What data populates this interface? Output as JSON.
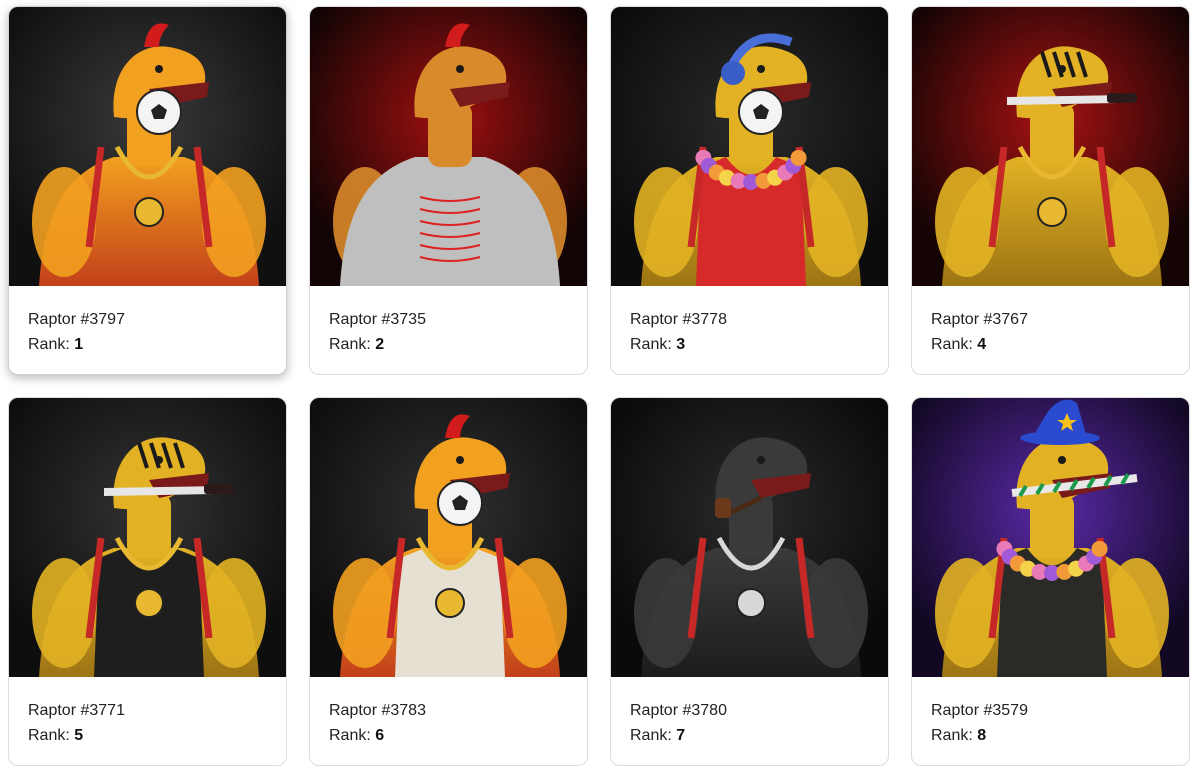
{
  "cards": [
    {
      "name": "Raptor #3797",
      "rank_label": "Rank:",
      "rank": "1",
      "bg": "#101010",
      "glow": "#3a3a3a",
      "skin": "#f2a020",
      "skin_dark": "#c2401a",
      "outfit": "none",
      "outfit_color": "#e63a1a",
      "accessory": "soccer-ball",
      "hat": "mohawk",
      "chain": "gold-watch",
      "hovered": true
    },
    {
      "name": "Raptor #3735",
      "rank_label": "Rank:",
      "rank": "2",
      "bg": "#120404",
      "glow": "#a01010",
      "skin": "#d98a2a",
      "skin_dark": "#7a7a7a",
      "outfit": "armor",
      "outfit_color": "#bfbfbf",
      "accessory": "none",
      "hat": "mohawk",
      "chain": "none",
      "hovered": false
    },
    {
      "name": "Raptor #3778",
      "rank_label": "Rank:",
      "rank": "3",
      "bg": "#0c0c0c",
      "glow": "#2a2a2a",
      "skin": "#e2b224",
      "skin_dark": "#9c7414",
      "outfit": "tank",
      "outfit_color": "#d62a2a",
      "accessory": "soccer-ball",
      "hat": "headphones",
      "chain": "lei",
      "hovered": false
    },
    {
      "name": "Raptor #3767",
      "rank_label": "Rank:",
      "rank": "4",
      "bg": "#150404",
      "glow": "#a81212",
      "skin": "#e2b224",
      "skin_dark": "#9c7414",
      "outfit": "none",
      "outfit_color": "#e2b224",
      "accessory": "knife",
      "hat": "tiger-stripes",
      "chain": "gold-x",
      "hovered": false
    },
    {
      "name": "Raptor #3771",
      "rank_label": "Rank:",
      "rank": "5",
      "bg": "#0e0e0e",
      "glow": "#333333",
      "skin": "#e2b224",
      "skin_dark": "#9c7414",
      "outfit": "tank",
      "outfit_color": "#1e1e1e",
      "accessory": "knife",
      "hat": "tiger-stripes",
      "chain": "gold-x",
      "hovered": false
    },
    {
      "name": "Raptor #3783",
      "rank_label": "Rank:",
      "rank": "6",
      "bg": "#0e0e0e",
      "glow": "#303030",
      "skin": "#f2a020",
      "skin_dark": "#c2401a",
      "outfit": "tank",
      "outfit_color": "#e6e0d2",
      "accessory": "soccer-ball",
      "hat": "mohawk",
      "chain": "gold-gem",
      "hovered": false
    },
    {
      "name": "Raptor #3780",
      "rank_label": "Rank:",
      "rank": "7",
      "bg": "#0a0a0a",
      "glow": "#2a2a2a",
      "skin": "#3a3a3a",
      "skin_dark": "#1c1c1c",
      "outfit": "none",
      "outfit_color": "#2a2a2a",
      "accessory": "pipe",
      "hat": "none",
      "chain": "silver-b",
      "hovered": false
    },
    {
      "name": "Raptor #3579",
      "rank_label": "Rank:",
      "rank": "8",
      "bg": "#120824",
      "glow": "#5a2aa8",
      "skin": "#e2b224",
      "skin_dark": "#9c7414",
      "outfit": "tank",
      "outfit_color": "#2a2a26",
      "accessory": "candy-cane",
      "hat": "wizard",
      "chain": "lei",
      "hovered": false
    }
  ]
}
